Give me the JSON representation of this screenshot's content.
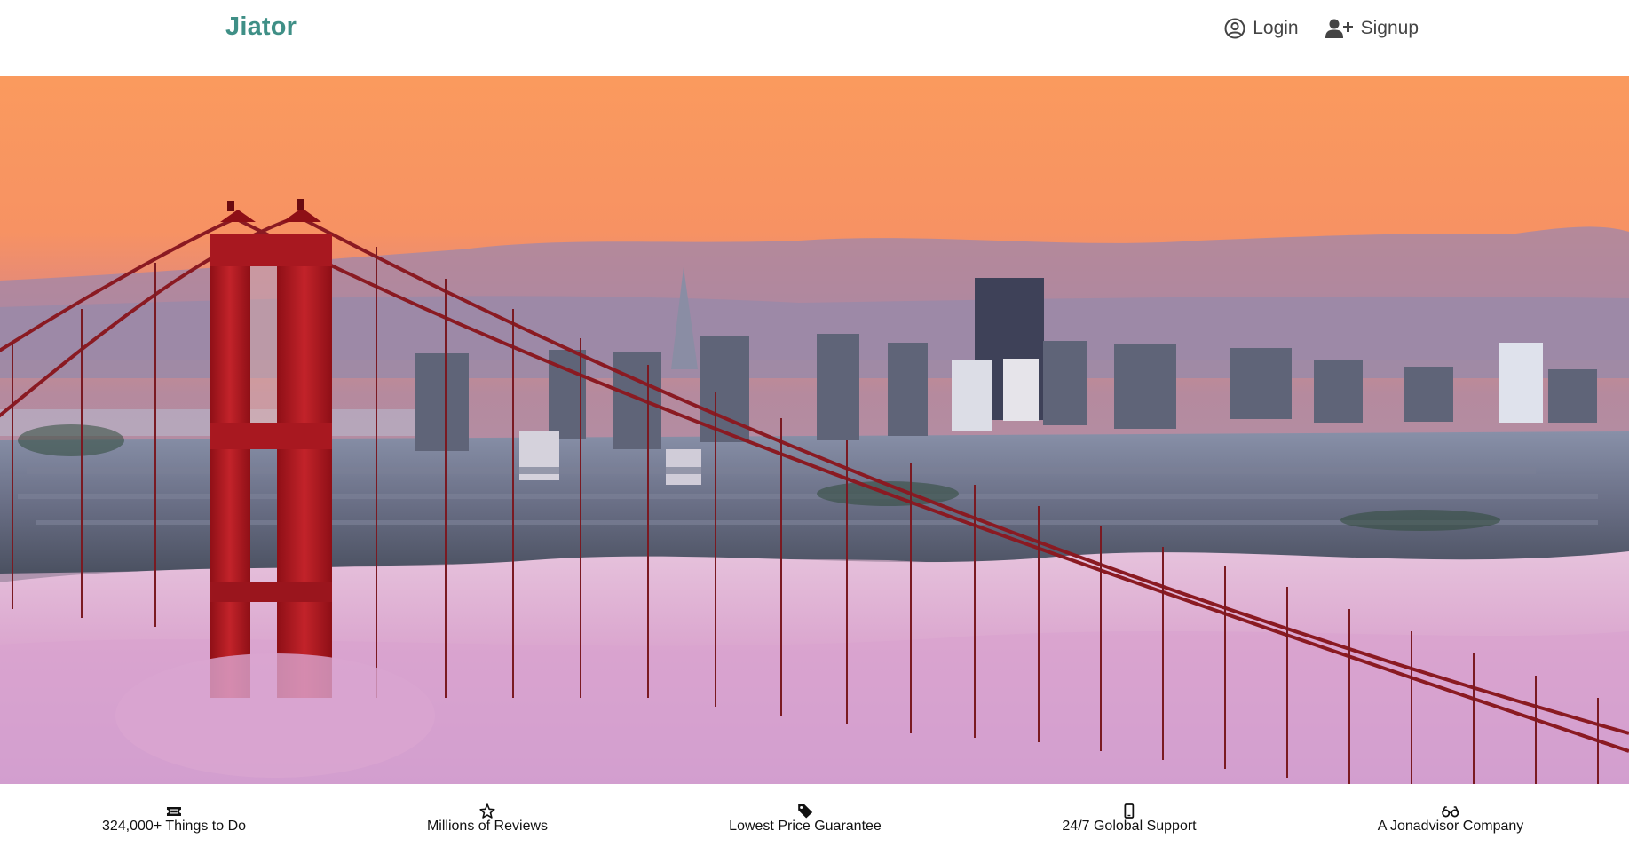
{
  "navbar": {
    "brand": "Jiator",
    "login_label": "Login",
    "signup_label": "Signup",
    "login_icon": "user-circle-icon",
    "signup_icon": "user-plus-icon"
  },
  "hero": {
    "image": "golden-gate-bridge-san-francisco-skyline-sunset-fog"
  },
  "features": [
    {
      "icon": "ticket-icon",
      "label": "324,000+ Things to Do"
    },
    {
      "icon": "star-outline-icon",
      "label": "Millions of Reviews"
    },
    {
      "icon": "tag-icon",
      "label": "Lowest Price Guarantee"
    },
    {
      "icon": "mobile-phone-icon",
      "label": "24/7 Golobal Support"
    },
    {
      "icon": "glasses-icon",
      "label": "A Jonadvisor Company"
    }
  ],
  "colors": {
    "brand": "#3f8f86",
    "nav_text": "#444444",
    "sky_top": "#fa9a5e",
    "bridge": "#b3161d",
    "fog": "#d8a4cc"
  }
}
